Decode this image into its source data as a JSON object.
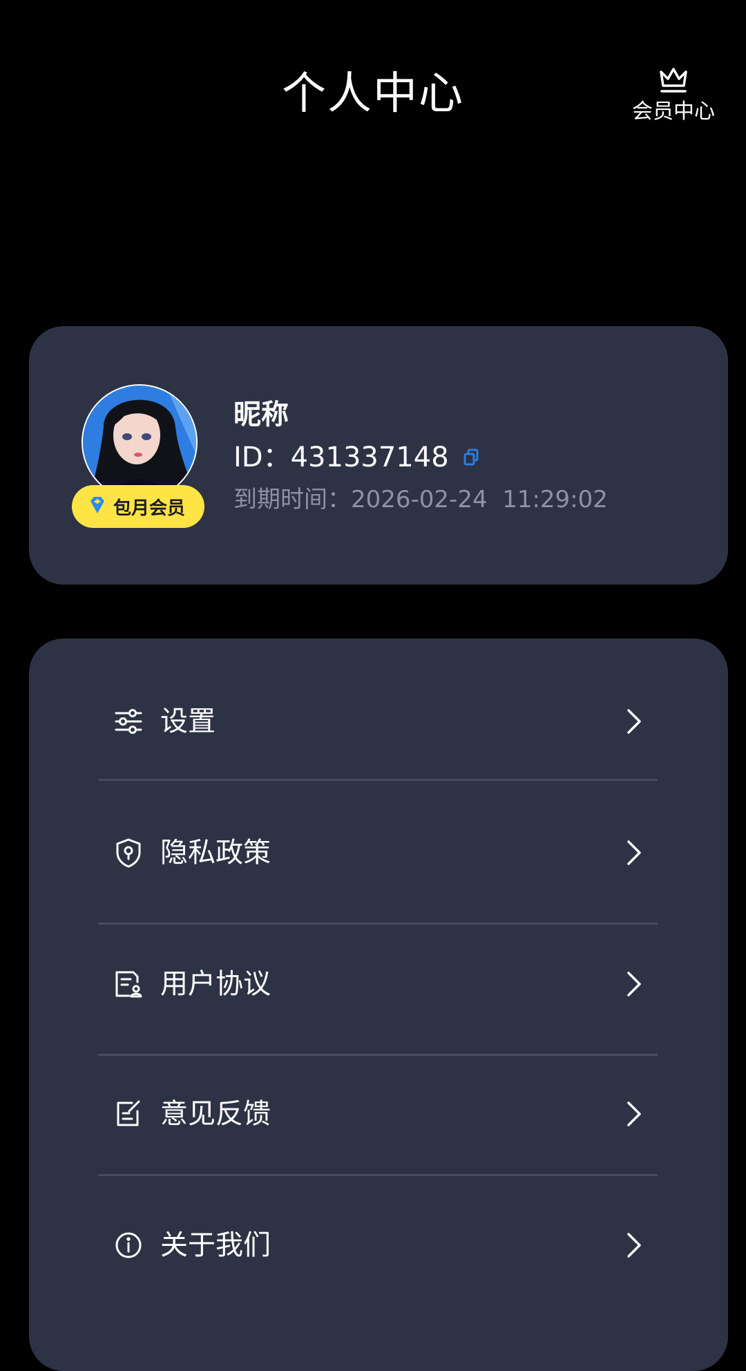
{
  "header": {
    "title": "个人中心",
    "vip_center_label": "会员中心"
  },
  "profile": {
    "nickname": "昵称",
    "id_text": "ID：431337148",
    "expire_text": "到期时间：2026-02-24  11:29:02",
    "badge_label": "包月会员"
  },
  "menu": {
    "items": [
      {
        "label": "设置",
        "icon": "sliders-icon"
      },
      {
        "label": "隐私政策",
        "icon": "shield-icon"
      },
      {
        "label": "用户协议",
        "icon": "document-user-icon"
      },
      {
        "label": "意见反馈",
        "icon": "edit-note-icon"
      },
      {
        "label": "关于我们",
        "icon": "info-icon"
      }
    ]
  },
  "colors": {
    "background": "#000000",
    "card": "#2e3245",
    "badge": "#ffe446",
    "accent_blue": "#2f7de0",
    "muted_text": "#8e92a2"
  }
}
